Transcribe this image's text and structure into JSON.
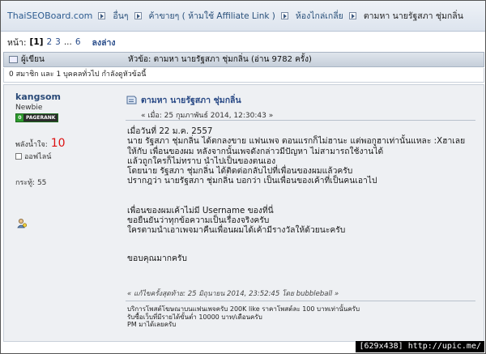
{
  "breadcrumb": {
    "items": [
      "ThaiSEOBoard.com",
      "อื่นๆ",
      "ค้าขายๆ ( ห้ามใช้ Affiliate Link )",
      "ห้องไกล่เกลี่ย",
      "ตามหา นายรัฐสภา ชุ่มกลิ่น"
    ]
  },
  "pager": {
    "label": "หน้า:",
    "current": "[1]",
    "pages": [
      "2",
      "3"
    ],
    "ellipsis": "...",
    "last": "6",
    "down": "ลงล่าง"
  },
  "header": {
    "author_col": "ผู้เขียน",
    "topic_col": "หัวข้อ: ตามหา นายรัฐสภา ชุ่มกลิ่น  (อ่าน 9782 ครั้ง)"
  },
  "viewers": "0 สมาชิก และ 1 บุคคลทั่วไป กำลังดูหัวข้อนี้",
  "poster": {
    "username": "kangsom",
    "rank": "Newbie",
    "pagerank_num": "0",
    "pagerank_label": "PAGERANK",
    "karma_label": "พลังน้ำใจ:",
    "karma_value": "10",
    "status": "ออฟไลน์",
    "posts": "กระทู้: 55"
  },
  "post": {
    "subject": "ตามหา นายรัฐสภา ชุ่มกลิ่น",
    "date": "« เมื่อ: 25 กุมภาพันธ์ 2014, 12:30:43 »",
    "lines_a": [
      "เมื่อวันที่ 22 ม.ค. 2557",
      "นาย รัฐสภา ชุ่มกลิ่น ได้ตกลงขาย แฟนเพจ ตอนแรกก็ไม่ฮานะ แต่พอกูฮาเท่านั้นแหละ :Xฮาเลย",
      "ให้กับ เพื่อนของผม หลังจากนั้นเพจดังกล่าวมีปัญหา ไม่สามารถใช้งานได้",
      "แล้วถูกใครก็ไม่ทราบ  นำไปเป็นของตนเอง",
      "โดยนาย รัฐสภา ชุ่มกลิ่น ได้ติดต่อกลับไปที่เพื่อนของผมแล้วครับ",
      "ปรากฎว่า นายรัฐสภา ชุ่มกลิ่น บอกว่า เป็นเพื่อนของเค้าที่เป็นคนเอาไป"
    ],
    "lines_b": [
      "เพื่อนของผมเค้าไม่มี Username ของที่นี่",
      "ขอยืนยันว่าทุกข้อความเป็นเรื่องจริงครับ",
      "ใครตามนำเอาเพจมาคืนเพื่อนผมได้เค้ามีรางวัลให้ด้วยนะครับ"
    ],
    "thanks": "ขอบคุณมากครับ",
    "edited": "« แก้ไขครั้งสุดท้าย: 25 มิถุนายน 2014, 23:52:45 โดย bubbleball »",
    "signature": [
      "บริการโพสต์โฆษณาบนแฟนเพจครับ 200K like ราคาโพสต์ละ 100 บาทเท่านั้นครับ",
      "รับซื้อเว็บที่มีรายได้ขั้นต่ำ 10000 บาท/เดือนครับ",
      "PM มาได้เลยครับ"
    ]
  },
  "watermark": "[629x438] http://upic.me/",
  "colors": {
    "link": "#2a4a86",
    "karma": "#dd1111",
    "header_bg": "#c6cfda",
    "post_bg": "#eef0f3"
  }
}
